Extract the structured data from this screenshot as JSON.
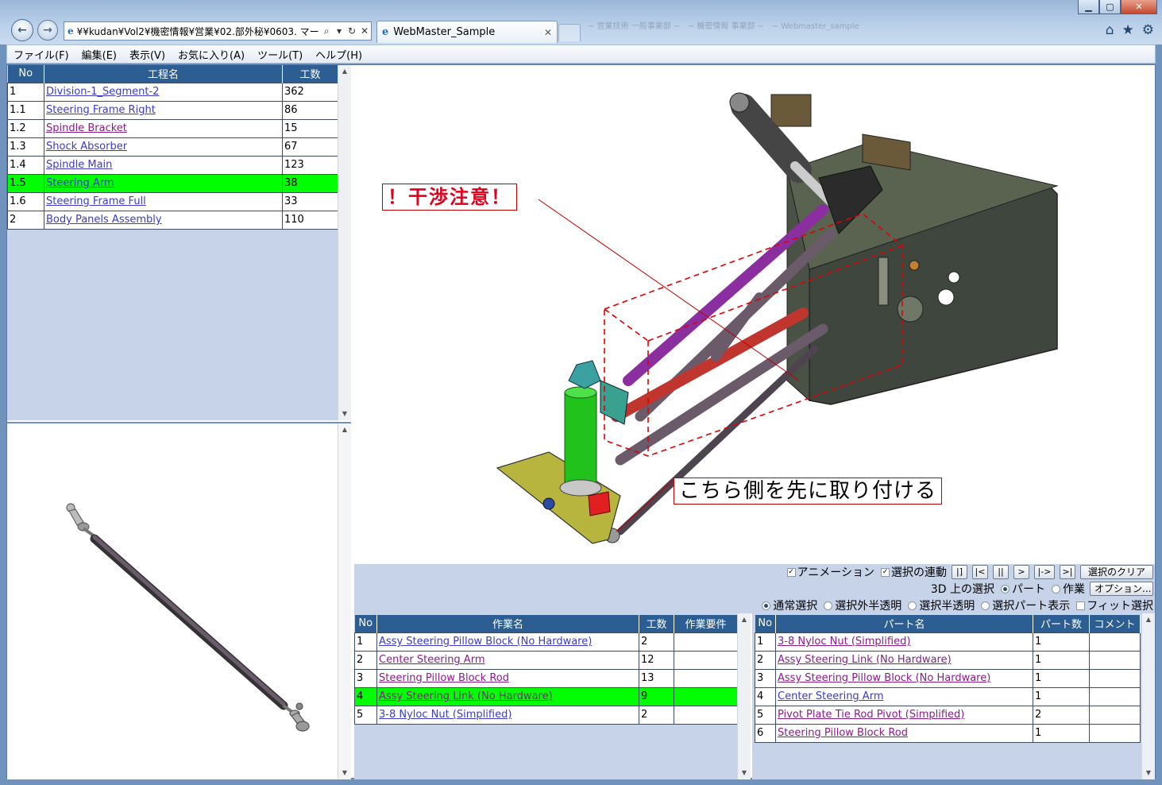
{
  "browser": {
    "address": "¥¥kudan¥Vol2¥機密情報¥営業¥02.部外秘¥0603. マー",
    "tab_title": "WebMaster_Sample",
    "ghost_tabs": [
      "~ 営業技術 一般事業部 ~",
      "~ 機密情報 事業部 ~",
      "~ Webmaster_sample"
    ]
  },
  "menu": [
    "ファイル(F)",
    "編集(E)",
    "表示(V)",
    "お気に入り(A)",
    "ツール(T)",
    "ヘルプ(H)"
  ],
  "process_table": {
    "headers": [
      "No",
      "工程名",
      "工数"
    ],
    "rows": [
      {
        "no": "1",
        "name": "Division-1_Segment-2",
        "hours": "362",
        "visited": false,
        "selected": false
      },
      {
        "no": "1.1",
        "name": "Steering Frame Right",
        "hours": "86",
        "visited": false,
        "selected": false
      },
      {
        "no": "1.2",
        "name": "Spindle Bracket",
        "hours": "15",
        "visited": true,
        "selected": false
      },
      {
        "no": "1.3",
        "name": "Shock Absorber",
        "hours": "67",
        "visited": false,
        "selected": false
      },
      {
        "no": "1.4",
        "name": "Spindle Main",
        "hours": "123",
        "visited": false,
        "selected": false
      },
      {
        "no": "1.5",
        "name": "Steering Arm",
        "hours": "38",
        "visited": false,
        "selected": true
      },
      {
        "no": "1.6",
        "name": "Steering Frame Full",
        "hours": "33",
        "visited": false,
        "selected": false
      },
      {
        "no": "2",
        "name": "Body Panels Assembly",
        "hours": "110",
        "visited": false,
        "selected": false
      }
    ]
  },
  "callouts": {
    "interference": "！干渉注意！",
    "install_first": "こちら側を先に取り付ける"
  },
  "controls": {
    "animation": "アニメーション",
    "selection_link": "選択の連動",
    "clear_selection": "選択のクリア",
    "options": "オプション...",
    "select_on_3d": "3D 上の選択",
    "part": "パート",
    "task": "作業",
    "normal_select": "通常選択",
    "outside_translucent": "選択外半透明",
    "select_translucent": "選択半透明",
    "selected_parts_only": "選択パート表示",
    "fit_select": "フィット選択",
    "playback": [
      "|]",
      "|<",
      "||",
      ">",
      "|->",
      ">|"
    ]
  },
  "task_table": {
    "headers": [
      "No",
      "作業名",
      "工数",
      "作業要件"
    ],
    "rows": [
      {
        "no": "1",
        "name": "Assy Steering Pillow Block (No Hardware)",
        "hours": "2",
        "req": "",
        "visited": false,
        "selected": false
      },
      {
        "no": "2",
        "name": "Center Steering Arm",
        "hours": "12",
        "req": "",
        "visited": true,
        "selected": false
      },
      {
        "no": "3",
        "name": "Steering Pillow Block Rod",
        "hours": "13",
        "req": "",
        "visited": true,
        "selected": false
      },
      {
        "no": "4",
        "name": "Assy Steering Link (No Hardware)",
        "hours": "9",
        "req": "",
        "visited": true,
        "selected": true
      },
      {
        "no": "5",
        "name": "3-8 Nyloc Nut (Simplified)",
        "hours": "2",
        "req": "",
        "visited": false,
        "selected": false
      }
    ]
  },
  "parts_table": {
    "headers": [
      "No",
      "パート名",
      "パート数",
      "コメント"
    ],
    "rows": [
      {
        "no": "1",
        "name": "3-8 Nyloc Nut (Simplified)",
        "count": "1",
        "comment": "",
        "visited": true
      },
      {
        "no": "2",
        "name": "Assy Steering Link (No Hardware)",
        "count": "1",
        "comment": "",
        "visited": true
      },
      {
        "no": "3",
        "name": "Assy Steering Pillow Block (No Hardware)",
        "count": "1",
        "comment": "",
        "visited": true
      },
      {
        "no": "4",
        "name": "Center Steering Arm",
        "count": "1",
        "comment": "",
        "visited": false
      },
      {
        "no": "5",
        "name": "Pivot Plate Tie Rod Pivot (Simplified)",
        "count": "2",
        "comment": "",
        "visited": true
      },
      {
        "no": "6",
        "name": "Steering Pillow Block Rod",
        "count": "1",
        "comment": "",
        "visited": true
      }
    ]
  }
}
